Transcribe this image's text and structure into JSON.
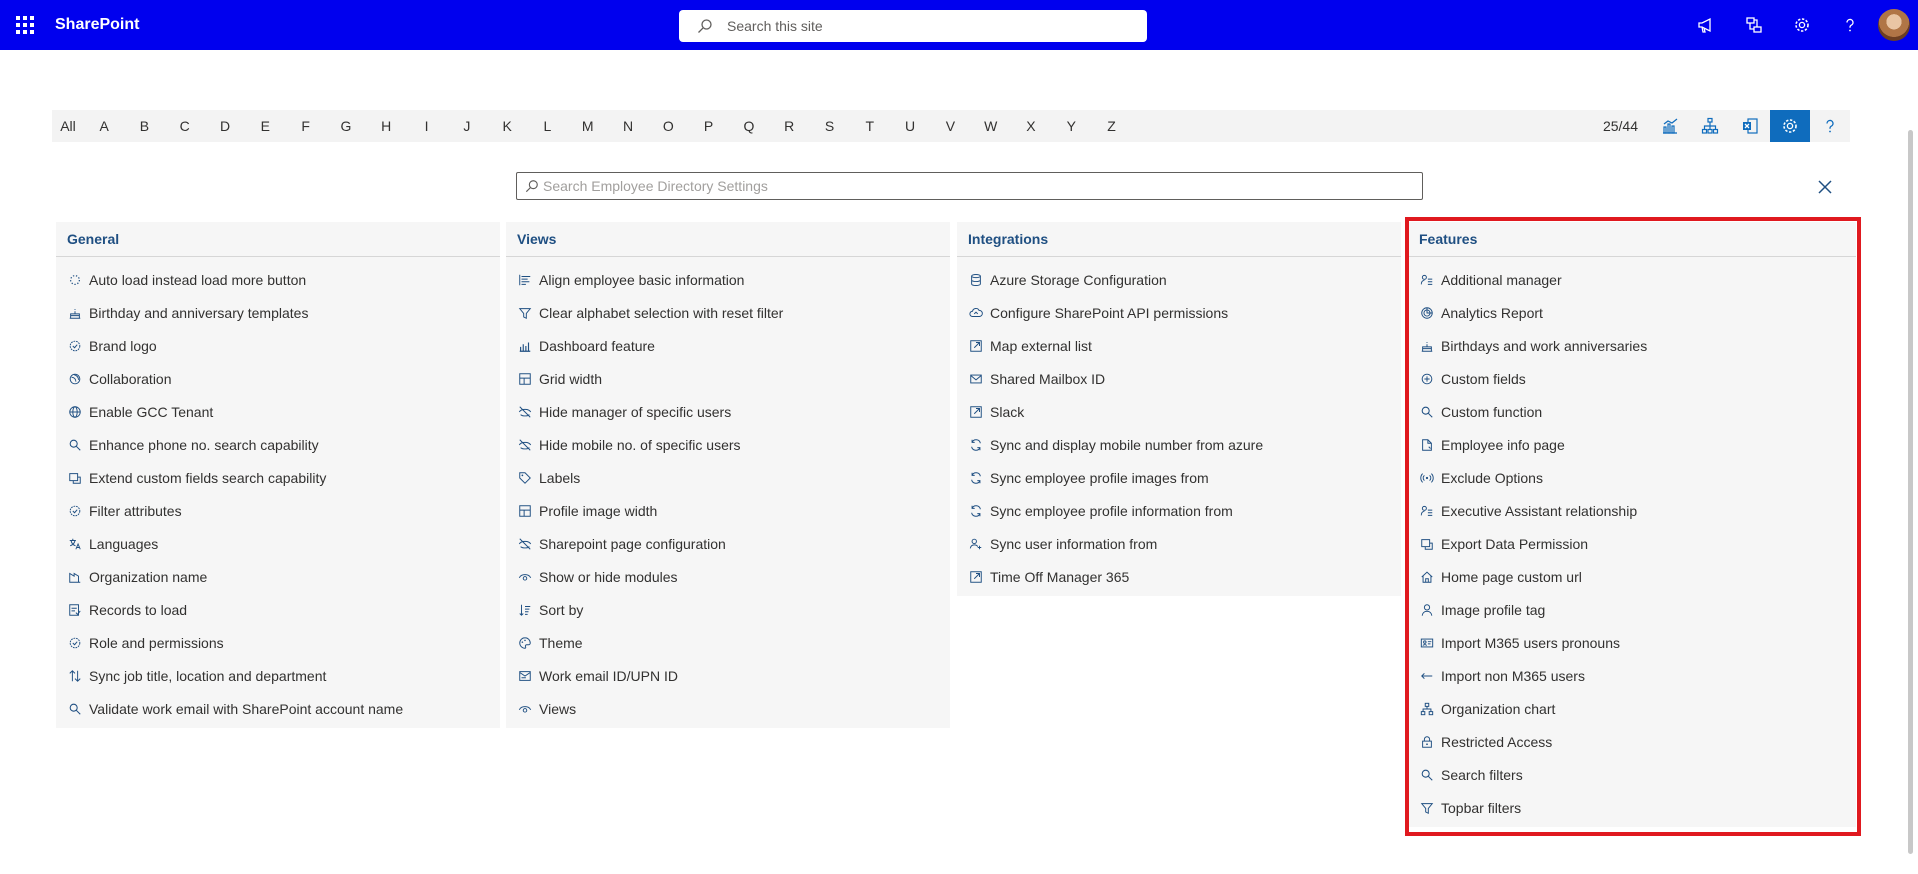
{
  "suite": {
    "brand": "SharePoint",
    "search_placeholder": "Search this site",
    "icons": [
      "megaphone-icon",
      "share-icon",
      "gear-icon",
      "help-icon"
    ]
  },
  "alphabet": {
    "letters": [
      "All",
      "A",
      "B",
      "C",
      "D",
      "E",
      "F",
      "G",
      "H",
      "I",
      "J",
      "K",
      "L",
      "M",
      "N",
      "O",
      "P",
      "Q",
      "R",
      "S",
      "T",
      "U",
      "V",
      "W",
      "X",
      "Y",
      "Z"
    ],
    "count": "25/44",
    "buttons": [
      "analytics-icon",
      "org-chart-icon",
      "export-excel-icon",
      "settings-icon",
      "help-icon"
    ]
  },
  "settings_search": {
    "placeholder": "Search Employee Directory Settings"
  },
  "columns": [
    {
      "title": "General",
      "items": [
        {
          "label": "Auto load instead load more button",
          "icon": "loading-icon"
        },
        {
          "label": "Birthday and anniversary templates",
          "icon": "cake-icon"
        },
        {
          "label": "Brand logo",
          "icon": "badge-icon"
        },
        {
          "label": "Collaboration",
          "icon": "collaboration-icon"
        },
        {
          "label": "Enable GCC Tenant",
          "icon": "globe-icon"
        },
        {
          "label": "Enhance phone no. search capability",
          "icon": "search-icon"
        },
        {
          "label": "Extend custom fields search capability",
          "icon": "extend-icon"
        },
        {
          "label": "Filter attributes",
          "icon": "badge-icon"
        },
        {
          "label": "Languages",
          "icon": "language-icon"
        },
        {
          "label": "Organization name",
          "icon": "organization-icon"
        },
        {
          "label": "Records to load",
          "icon": "records-icon"
        },
        {
          "label": "Role and permissions",
          "icon": "badge-icon"
        },
        {
          "label": "Sync job title, location and department",
          "icon": "sync-arrows-icon"
        },
        {
          "label": "Validate work email with SharePoint account name",
          "icon": "search-icon"
        }
      ]
    },
    {
      "title": "Views",
      "items": [
        {
          "label": "Align employee basic information",
          "icon": "align-icon"
        },
        {
          "label": "Clear alphabet selection with reset filter",
          "icon": "filter-icon"
        },
        {
          "label": "Dashboard feature",
          "icon": "dashboard-icon"
        },
        {
          "label": "Grid width",
          "icon": "grid-icon"
        },
        {
          "label": "Hide manager of specific users",
          "icon": "hide-icon"
        },
        {
          "label": "Hide mobile no. of specific users",
          "icon": "hide-icon"
        },
        {
          "label": "Labels",
          "icon": "tag-icon"
        },
        {
          "label": "Profile image width",
          "icon": "grid-icon"
        },
        {
          "label": "Sharepoint page configuration",
          "icon": "hide-icon"
        },
        {
          "label": "Show or hide modules",
          "icon": "eye-icon"
        },
        {
          "label": "Sort by",
          "icon": "sort-icon"
        },
        {
          "label": "Theme",
          "icon": "palette-icon"
        },
        {
          "label": "Work email ID/UPN ID",
          "icon": "email-icon"
        },
        {
          "label": "Views",
          "icon": "eye-icon"
        }
      ]
    },
    {
      "title": "Integrations",
      "items": [
        {
          "label": "Azure Storage Configuration",
          "icon": "database-icon"
        },
        {
          "label": "Configure SharePoint API permissions",
          "icon": "cloud-icon"
        },
        {
          "label": "Map external list",
          "icon": "external-icon"
        },
        {
          "label": "Shared Mailbox ID",
          "icon": "mail-icon"
        },
        {
          "label": "Slack",
          "icon": "external-icon"
        },
        {
          "label": "Sync and display mobile number from azure",
          "icon": "sync-icon"
        },
        {
          "label": "Sync employee profile images from",
          "icon": "sync-icon"
        },
        {
          "label": "Sync employee profile information from",
          "icon": "sync-icon"
        },
        {
          "label": "Sync user information from",
          "icon": "user-sync-icon"
        },
        {
          "label": "Time Off Manager 365",
          "icon": "external-icon"
        }
      ]
    },
    {
      "title": "Features",
      "items": [
        {
          "label": "Additional manager",
          "icon": "people-icon"
        },
        {
          "label": "Analytics Report",
          "icon": "analytics-icon"
        },
        {
          "label": "Birthdays and work anniversaries",
          "icon": "cake-icon"
        },
        {
          "label": "Custom fields",
          "icon": "plus-circle-icon"
        },
        {
          "label": "Custom function",
          "icon": "search-icon"
        },
        {
          "label": "Employee info page",
          "icon": "document-icon"
        },
        {
          "label": "Exclude Options",
          "icon": "broadcast-icon"
        },
        {
          "label": "Executive Assistant relationship",
          "icon": "people-icon"
        },
        {
          "label": "Export Data Permission",
          "icon": "extend-icon"
        },
        {
          "label": "Home page custom url",
          "icon": "home-icon"
        },
        {
          "label": "Image profile tag",
          "icon": "person-icon"
        },
        {
          "label": "Import M365 users pronouns",
          "icon": "contact-card-icon"
        },
        {
          "label": "Import non M365 users",
          "icon": "arrow-left-icon"
        },
        {
          "label": "Organization chart",
          "icon": "org-chart-icon"
        },
        {
          "label": "Restricted Access",
          "icon": "lock-icon"
        },
        {
          "label": "Search filters",
          "icon": "search-icon"
        },
        {
          "label": "Topbar filters",
          "icon": "filter-icon"
        }
      ]
    }
  ],
  "colors": {
    "suite_bar": "#0000ee",
    "accent": "#0f6cbd",
    "heading": "#1f4f82",
    "highlight": "#e0191f"
  }
}
